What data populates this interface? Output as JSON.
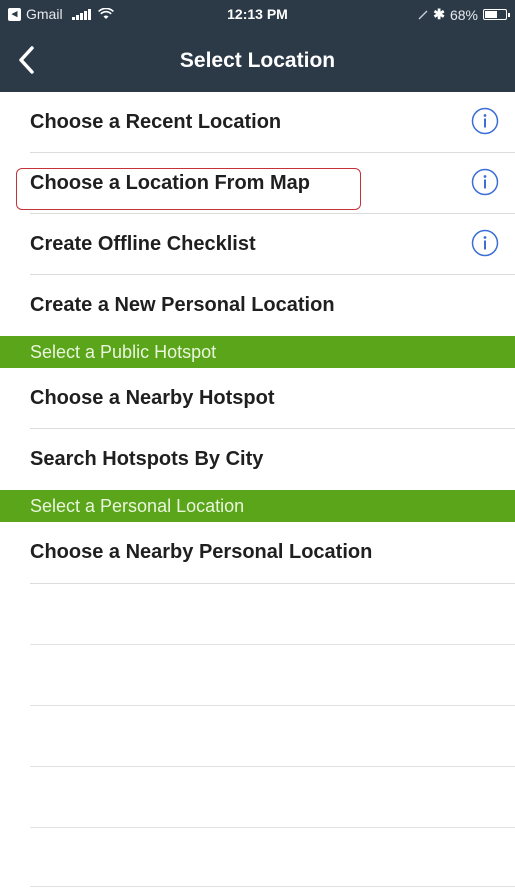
{
  "status_bar": {
    "back_app_name": "Gmail",
    "time": "12:13 PM",
    "battery_text": "68%",
    "battery_level": 0.68
  },
  "nav": {
    "title": "Select Location",
    "back_icon": "chevron-left-icon"
  },
  "colors": {
    "header_bg": "#2c3a47",
    "section_bg": "#5aa519",
    "info_icon": "#3b6fd6",
    "highlight": "#c4323a"
  },
  "rows_top": [
    {
      "label": "Choose a Recent Location",
      "has_info": true
    },
    {
      "label": "Choose a Location From Map",
      "has_info": true,
      "highlighted": true
    },
    {
      "label": "Create Offline Checklist",
      "has_info": true
    },
    {
      "label": "Create a New Personal Location",
      "has_info": false
    }
  ],
  "section_public": {
    "title": "Select a Public Hotspot",
    "rows": [
      {
        "label": "Choose a Nearby Hotspot"
      },
      {
        "label": "Search Hotspots By City"
      }
    ]
  },
  "section_personal": {
    "title": "Select a Personal Location",
    "rows": [
      {
        "label": "Choose a Nearby Personal Location"
      }
    ]
  }
}
